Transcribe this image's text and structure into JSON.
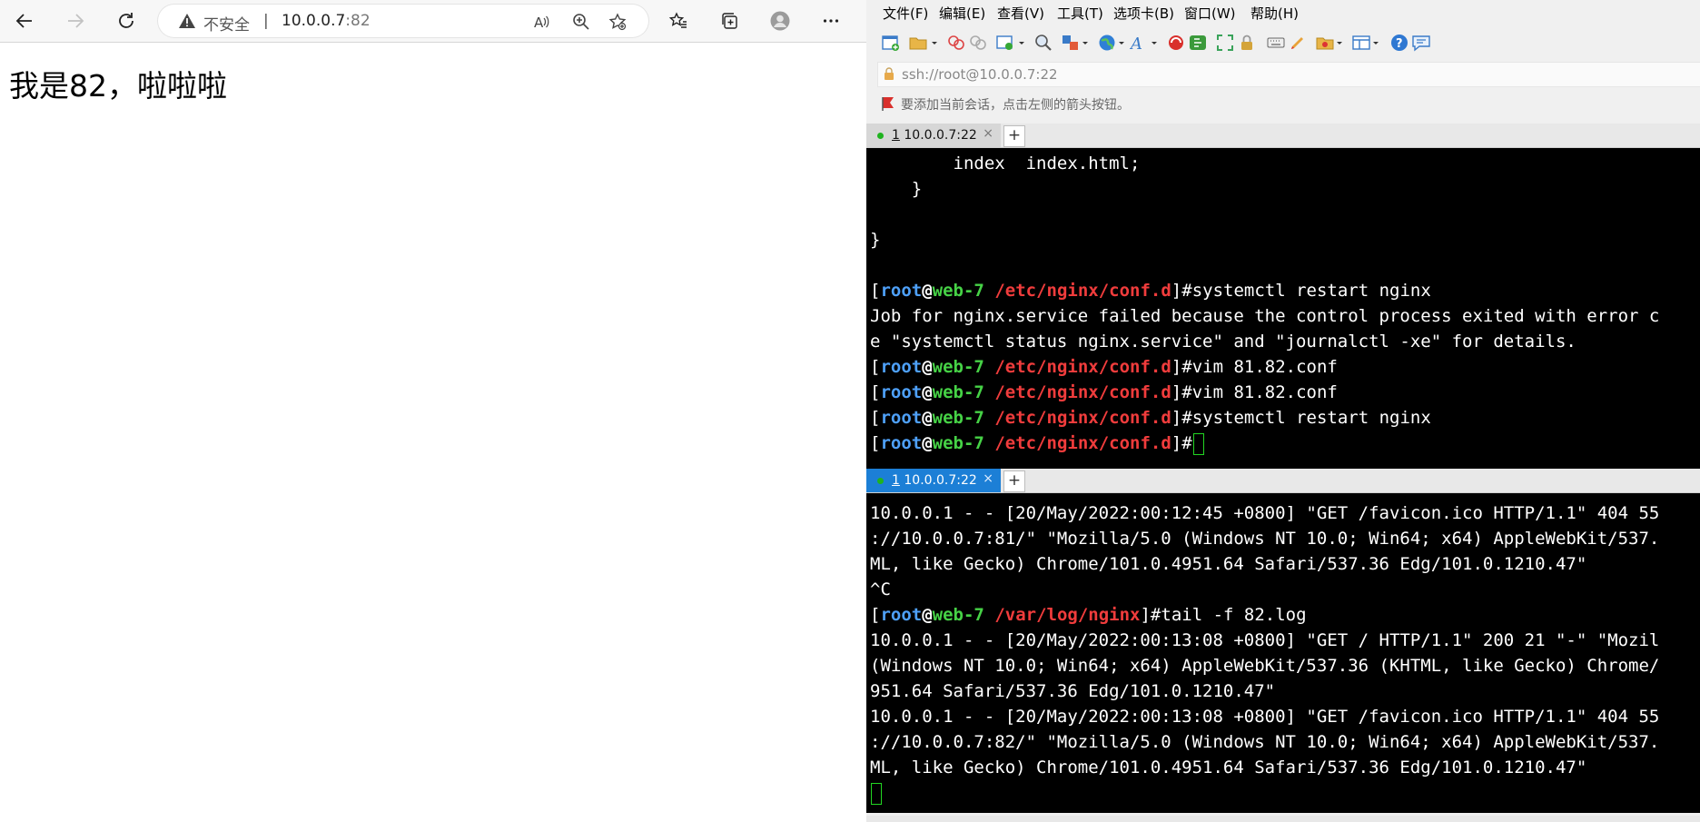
{
  "browser": {
    "address": {
      "insecure_label": "不安全",
      "separator": "|",
      "host": "10.0.0.7",
      "port": ":82"
    },
    "page_text": "我是82，啦啦啦"
  },
  "xshell": {
    "menu": [
      "文件(F)",
      "编辑(E)",
      "查看(V)",
      "工具(T)",
      "选项卡(B)",
      "窗口(W)",
      "帮助(H)"
    ],
    "address": "ssh://root@10.0.0.7:22",
    "hint": "要添加当前会话，点击左侧的箭头按钮。",
    "tab_top": {
      "number": "1",
      "label": "10.0.0.7:22",
      "close": "×",
      "add": "+"
    },
    "tab_bottom": {
      "number": "1",
      "label": "10.0.0.7:22",
      "close": "×",
      "add": "+"
    },
    "terminal_top": [
      {
        "type": "text",
        "text": "        index  index.html;"
      },
      {
        "type": "text",
        "text": "    }"
      },
      {
        "type": "text",
        "text": ""
      },
      {
        "type": "text",
        "text": "}"
      },
      {
        "type": "text",
        "text": ""
      },
      {
        "type": "prompt",
        "user": "root",
        "host": "web-7",
        "path": "/etc/nginx/conf.d",
        "cmd": "systemctl restart nginx"
      },
      {
        "type": "text",
        "text": "Job for nginx.service failed because the control process exited with error c"
      },
      {
        "type": "text",
        "text": "e \"systemctl status nginx.service\" and \"journalctl -xe\" for details."
      },
      {
        "type": "prompt",
        "user": "root",
        "host": "web-7",
        "path": "/etc/nginx/conf.d",
        "cmd": "vim 81.82.conf"
      },
      {
        "type": "prompt",
        "user": "root",
        "host": "web-7",
        "path": "/etc/nginx/conf.d",
        "cmd": "vim 81.82.conf"
      },
      {
        "type": "prompt",
        "user": "root",
        "host": "web-7",
        "path": "/etc/nginx/conf.d",
        "cmd": "systemctl restart nginx"
      },
      {
        "type": "prompt",
        "user": "root",
        "host": "web-7",
        "path": "/etc/nginx/conf.d",
        "cmd": "",
        "cursor": true
      }
    ],
    "terminal_bottom": [
      {
        "type": "text",
        "text": "10.0.0.1 - - [20/May/2022:00:12:45 +0800] \"GET /favicon.ico HTTP/1.1\" 404 55"
      },
      {
        "type": "text",
        "text": "://10.0.0.7:81/\" \"Mozilla/5.0 (Windows NT 10.0; Win64; x64) AppleWebKit/537."
      },
      {
        "type": "text",
        "text": "ML, like Gecko) Chrome/101.0.4951.64 Safari/537.36 Edg/101.0.1210.47\""
      },
      {
        "type": "text",
        "text": "^C"
      },
      {
        "type": "prompt",
        "user": "root",
        "host": "web-7",
        "path": "/var/log/nginx",
        "cmd": "tail -f 82.log"
      },
      {
        "type": "text",
        "text": "10.0.0.1 - - [20/May/2022:00:13:08 +0800] \"GET / HTTP/1.1\" 200 21 \"-\" \"Mozil"
      },
      {
        "type": "text",
        "text": "(Windows NT 10.0; Win64; x64) AppleWebKit/537.36 (KHTML, like Gecko) Chrome/"
      },
      {
        "type": "text",
        "text": "951.64 Safari/537.36 Edg/101.0.1210.47\""
      },
      {
        "type": "text",
        "text": "10.0.0.1 - - [20/May/2022:00:13:08 +0800] \"GET /favicon.ico HTTP/1.1\" 404 55"
      },
      {
        "type": "text",
        "text": "://10.0.0.7:82/\" \"Mozilla/5.0 (Windows NT 10.0; Win64; x64) AppleWebKit/537."
      },
      {
        "type": "text",
        "text": "ML, like Gecko) Chrome/101.0.4951.64 Safari/537.36 Edg/101.0.1210.47\""
      },
      {
        "type": "cursor"
      }
    ]
  }
}
